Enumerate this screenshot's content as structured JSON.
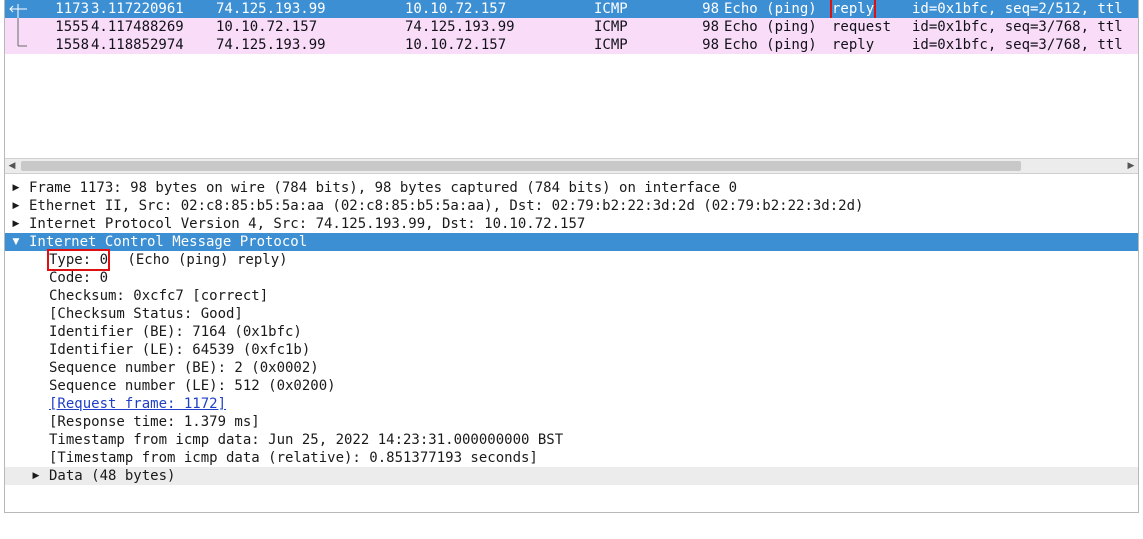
{
  "packets": [
    {
      "no": "1173",
      "time": "3.117220961",
      "source": "74.125.193.99",
      "destination": "10.10.72.157",
      "protocol": "ICMP",
      "length": "98",
      "info_a": "Echo (ping)",
      "info_b": "reply",
      "info_c": "id=0x1bfc, seq=2/512, ttl"
    },
    {
      "no": "1555",
      "time": "4.117488269",
      "source": "10.10.72.157",
      "destination": "74.125.193.99",
      "protocol": "ICMP",
      "length": "98",
      "info_a": "Echo (ping)",
      "info_b": "request",
      "info_c": "id=0x1bfc, seq=3/768, ttl"
    },
    {
      "no": "1558",
      "time": "4.118852974",
      "source": "74.125.193.99",
      "destination": "10.10.72.157",
      "protocol": "ICMP",
      "length": "98",
      "info_a": "Echo (ping)",
      "info_b": "reply",
      "info_c": "id=0x1bfc, seq=3/768, ttl"
    }
  ],
  "details": {
    "frame": "Frame 1173: 98 bytes on wire (784 bits), 98 bytes captured (784 bits) on interface 0",
    "ethernet": "Ethernet II, Src: 02:c8:85:b5:5a:aa (02:c8:85:b5:5a:aa), Dst: 02:79:b2:22:3d:2d (02:79:b2:22:3d:2d)",
    "ip": "Internet Protocol Version 4, Src: 74.125.193.99, Dst: 10.10.72.157",
    "icmp": "Internet Control Message Protocol",
    "type_label": "Type: 0",
    "type_suffix": " (Echo (ping) reply)",
    "code": "Code: 0",
    "checksum": "Checksum: 0xcfc7 [correct]",
    "checksum_status": "[Checksum Status: Good]",
    "identifier_be": "Identifier (BE): 7164 (0x1bfc)",
    "identifier_le": "Identifier (LE): 64539 (0xfc1b)",
    "seq_be": "Sequence number (BE): 2 (0x0002)",
    "seq_le": "Sequence number (LE): 512 (0x0200)",
    "request_frame": "[Request frame: 1172]",
    "response_time": "[Response time: 1.379 ms]",
    "timestamp": "Timestamp from icmp data: Jun 25, 2022 14:23:31.000000000 BST",
    "timestamp_rel": "[Timestamp from icmp data (relative): 0.851377193 seconds]",
    "data": "Data (48 bytes)"
  },
  "colors": {
    "selected": "#3c8fd3",
    "icmp_row": "#f8dcf8",
    "highlight": "#e01010",
    "link": "#1f3fc8"
  },
  "icons": {
    "collapsed": "triangle-right-icon",
    "expanded": "triangle-down-icon"
  }
}
